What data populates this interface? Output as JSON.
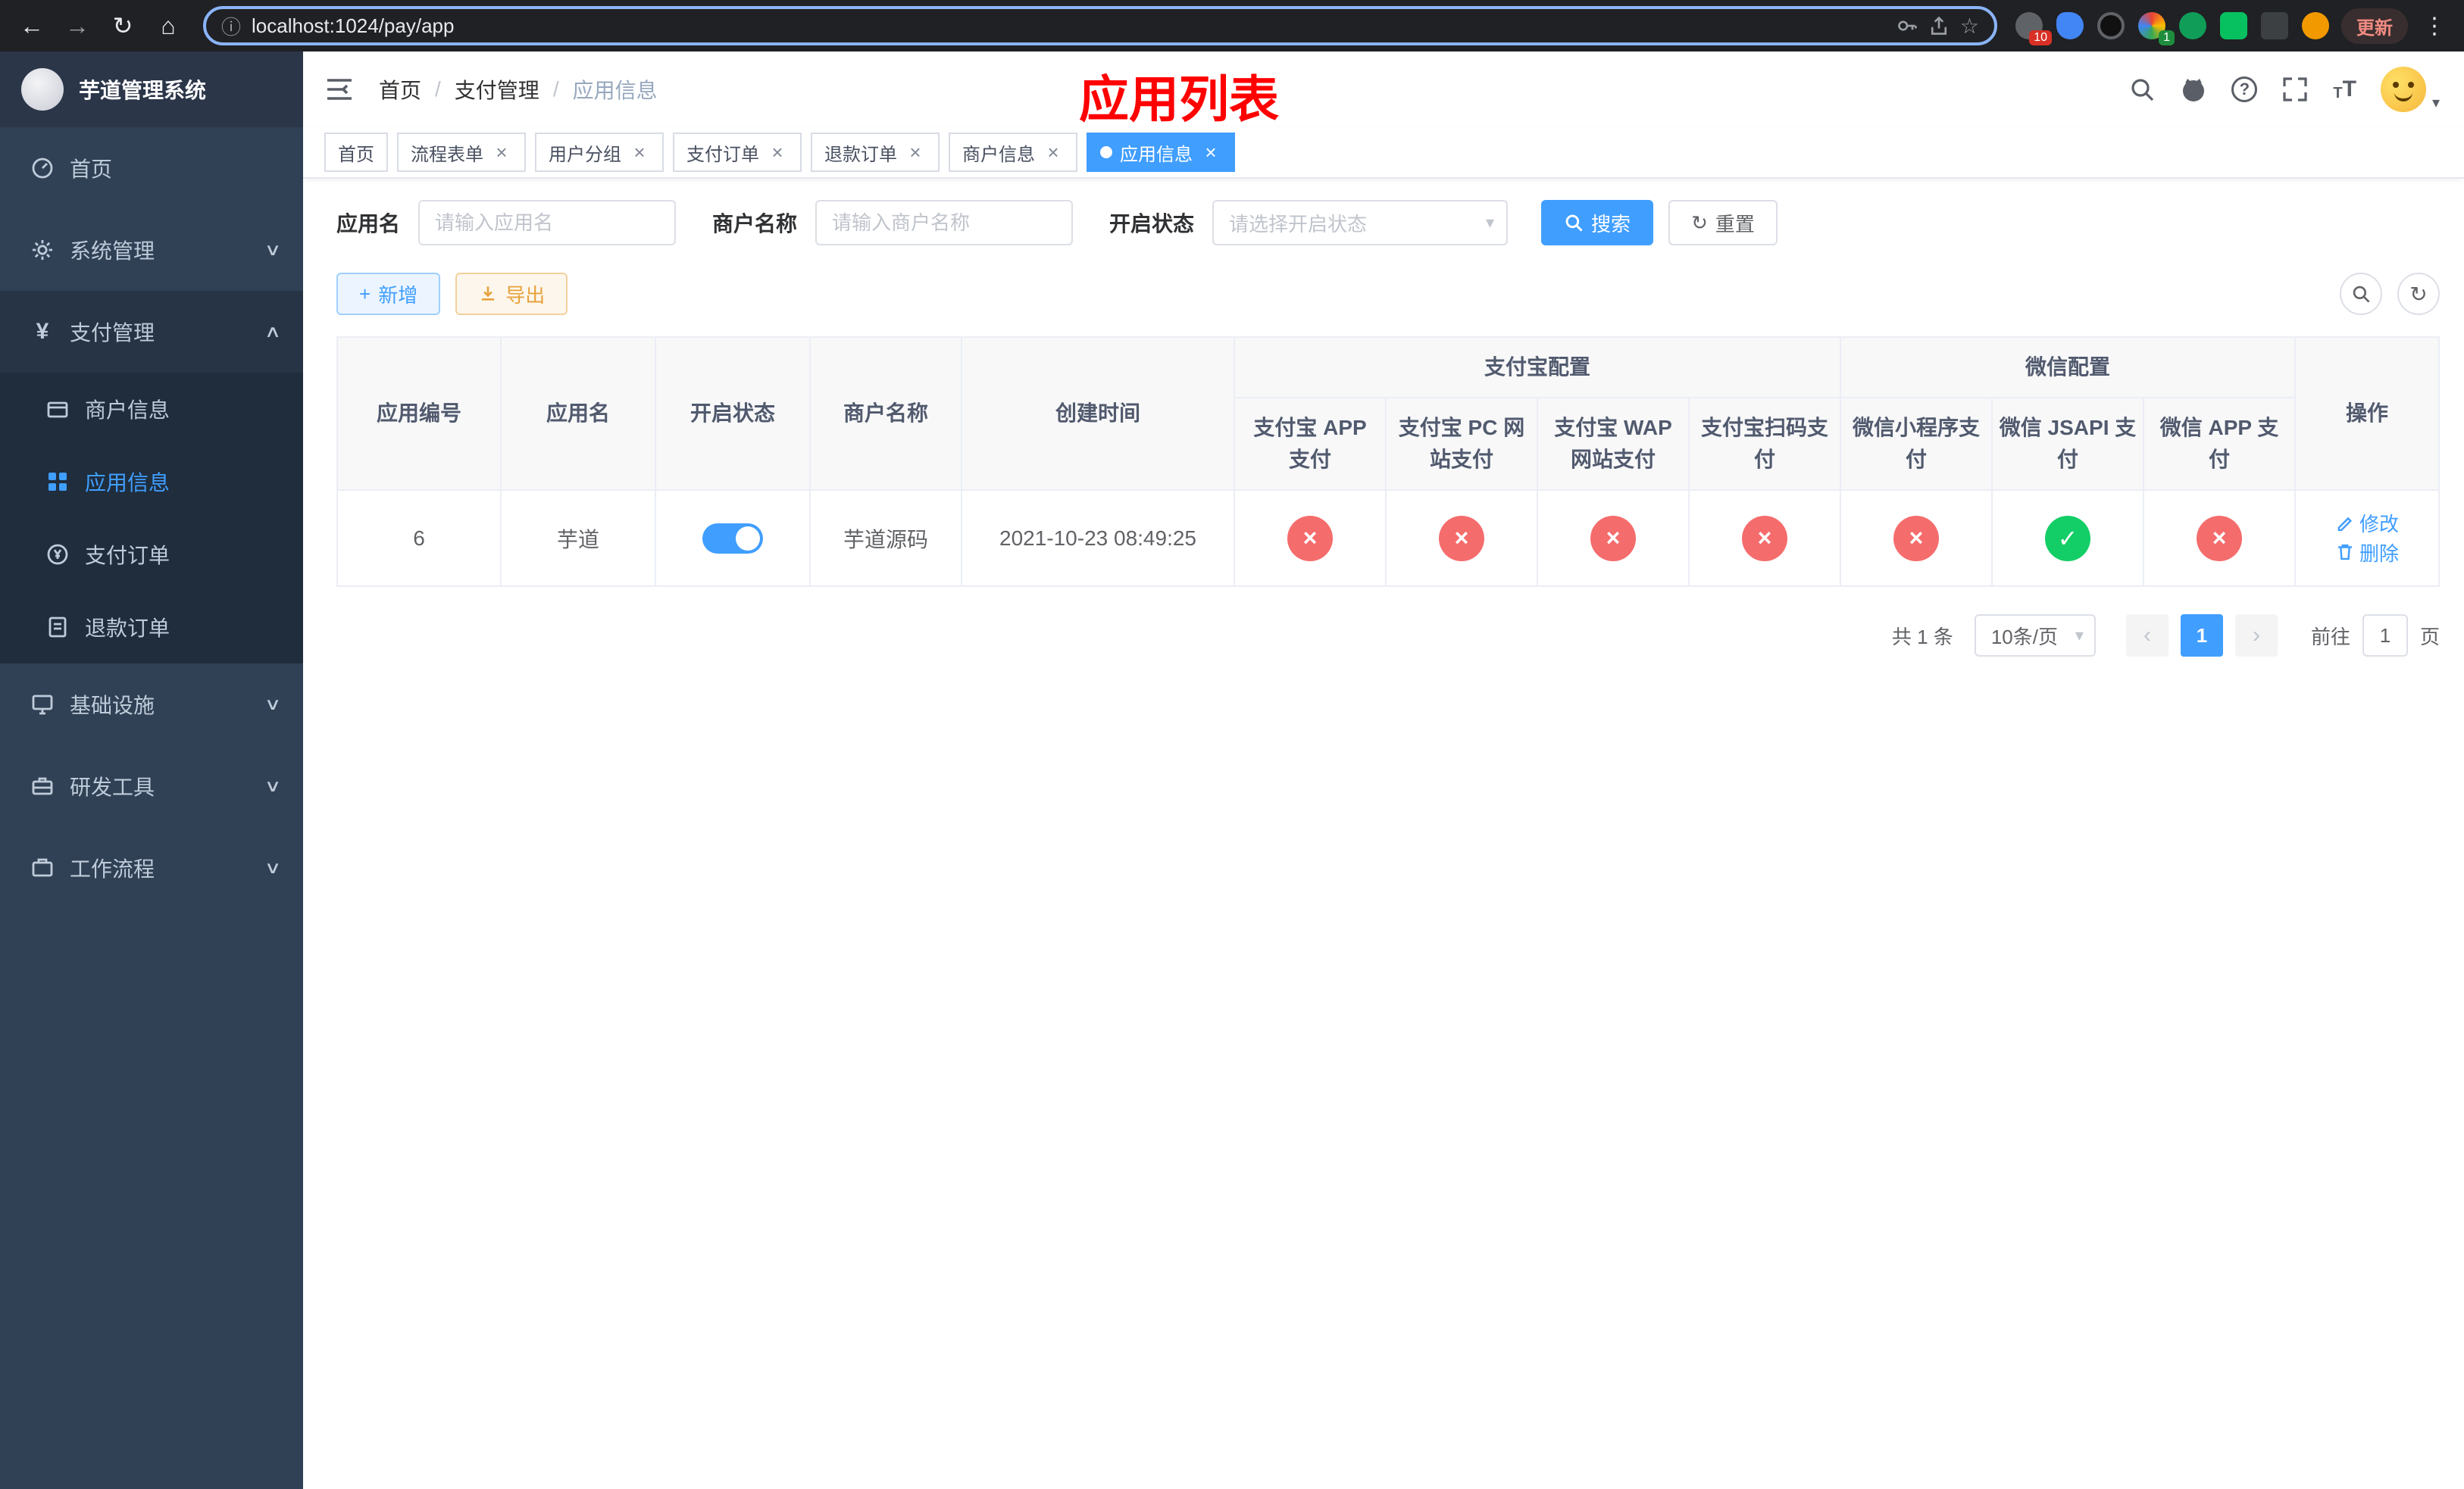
{
  "browser": {
    "url": "localhost:1024/pay/app",
    "update_label": "更新",
    "badges": {
      "ext1": "10",
      "ext4": "1"
    }
  },
  "colors": {
    "primary": "#409eff",
    "success": "#13ce66",
    "danger": "#f56c6c",
    "warning": "#e6a23c",
    "banner_red": "#ff0000",
    "sidebar_bg": "#304156",
    "submenu_bg": "#1f2d3d"
  },
  "sidebar": {
    "title": "芋道管理系统",
    "items": [
      {
        "label": "首页"
      },
      {
        "label": "系统管理"
      },
      {
        "label": "支付管理"
      },
      {
        "label": "基础设施"
      },
      {
        "label": "研发工具"
      },
      {
        "label": "工作流程"
      }
    ],
    "pay_children": [
      {
        "label": "商户信息"
      },
      {
        "label": "应用信息",
        "active": true
      },
      {
        "label": "支付订单"
      },
      {
        "label": "退款订单"
      }
    ]
  },
  "header": {
    "breadcrumb": [
      {
        "label": "首页"
      },
      {
        "label": "支付管理"
      },
      {
        "label": "应用信息"
      }
    ],
    "banner": "应用列表"
  },
  "tabs": [
    {
      "label": "首页",
      "closable": false
    },
    {
      "label": "流程表单",
      "closable": true
    },
    {
      "label": "用户分组",
      "closable": true
    },
    {
      "label": "支付订单",
      "closable": true
    },
    {
      "label": "退款订单",
      "closable": true
    },
    {
      "label": "商户信息",
      "closable": true
    },
    {
      "label": "应用信息",
      "closable": true,
      "active": true
    }
  ],
  "filters": {
    "app_name_label": "应用名",
    "app_name_placeholder": "请输入应用名",
    "merchant_label": "商户名称",
    "merchant_placeholder": "请输入商户名称",
    "status_label": "开启状态",
    "status_placeholder": "请选择开启状态",
    "search_label": "搜索",
    "reset_label": "重置"
  },
  "toolbar": {
    "add_label": "新增",
    "export_label": "导出"
  },
  "table": {
    "main_columns": [
      "应用编号",
      "应用名",
      "开启状态",
      "商户名称",
      "创建时间"
    ],
    "groups": [
      {
        "label": "支付宝配置",
        "cols": [
          "支付宝 APP 支付",
          "支付宝 PC 网站支付",
          "支付宝 WAP 网站支付",
          "支付宝扫码支付"
        ]
      },
      {
        "label": "微信配置",
        "cols": [
          "微信小程序支付",
          "微信 JSAPI 支付",
          "微信 APP 支付"
        ]
      }
    ],
    "op_label": "操作",
    "edit_label": "修改",
    "delete_label": "删除",
    "rows": [
      {
        "id": "6",
        "name": "芋道",
        "enabled": true,
        "merchant": "芋道源码",
        "created": "2021-10-23 08:49:25",
        "status_flags": [
          false,
          false,
          false,
          false,
          false,
          true,
          false
        ]
      }
    ]
  },
  "pagination": {
    "total": "共 1 条",
    "page_size": "10条/页",
    "current": "1",
    "goto_label": "前往",
    "goto_value": "1",
    "unit": "页"
  },
  "icons": {
    "back": "←",
    "forward": "→",
    "refresh": "↻",
    "home": "⌂",
    "info": "ⓘ",
    "star": "☆",
    "menu_dots": "⋮",
    "caret_down": "▾",
    "chevron_down": "∨",
    "chevron_up": "∧",
    "slash": "/",
    "close": "×",
    "check": "✓",
    "cross": "×",
    "plus": "+",
    "question": "?",
    "arrow_left": "‹",
    "arrow_right": "›",
    "yen": "¥",
    "letter_t": "T"
  }
}
